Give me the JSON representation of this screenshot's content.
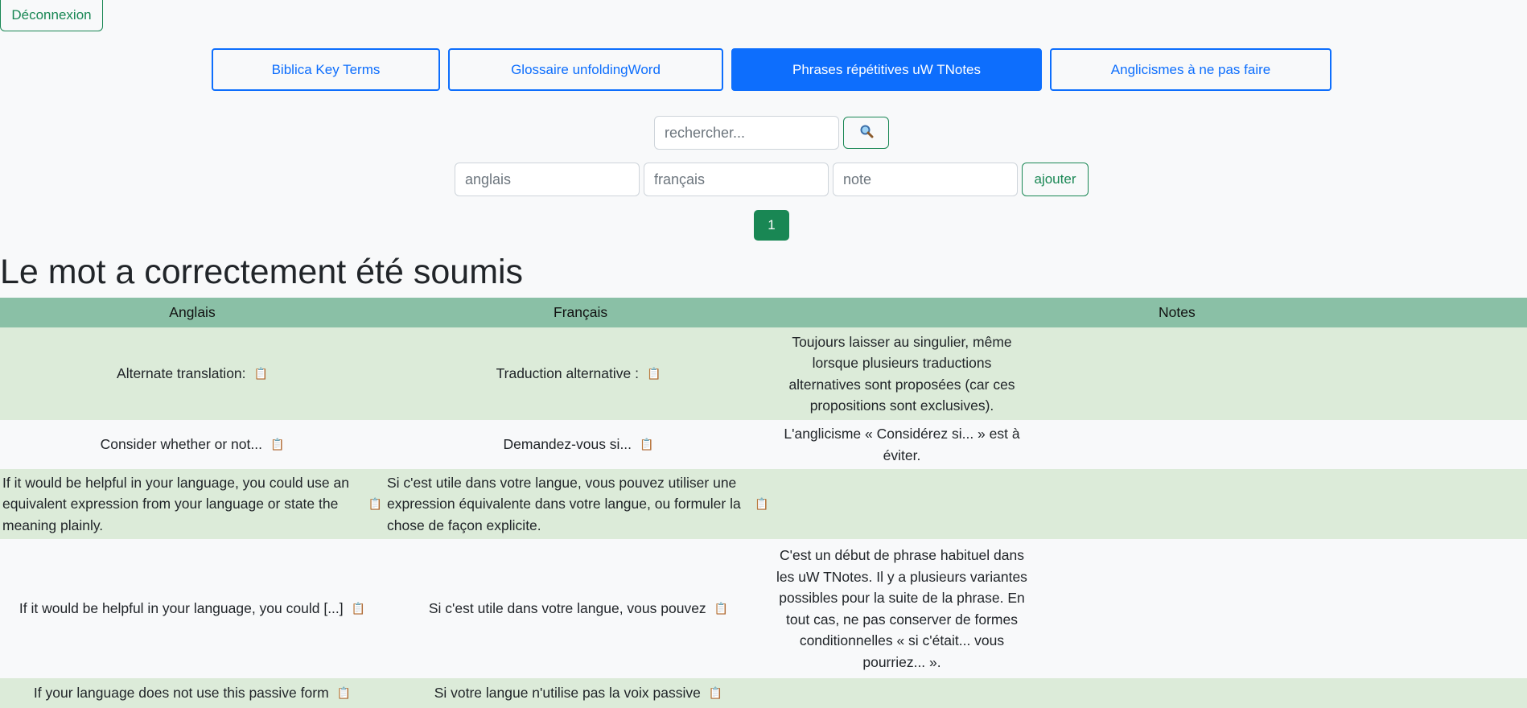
{
  "header": {
    "logout_label": "Déconnexion"
  },
  "tabs": [
    {
      "label": "Biblica Key Terms",
      "active": false
    },
    {
      "label": "Glossaire unfoldingWord",
      "active": false
    },
    {
      "label": "Phrases répétitives uW TNotes",
      "active": true
    },
    {
      "label": "Anglicismes à ne pas faire",
      "active": false
    }
  ],
  "search": {
    "placeholder": "rechercher...",
    "button_icon": "search-icon"
  },
  "add_form": {
    "english_placeholder": "anglais",
    "french_placeholder": "français",
    "note_placeholder": "note",
    "add_label": "ajouter"
  },
  "pagination": {
    "current_page": "1"
  },
  "message": "Le mot a correctement été soumis",
  "table": {
    "headers": {
      "english": "Anglais",
      "french": "Français",
      "notes": "Notes"
    },
    "rows": [
      {
        "english": "Alternate translation:",
        "french": "Traduction alternative :",
        "note": "Toujours laisser au singulier, même lorsque plusieurs traductions alternatives sont proposées (car ces propositions sont exclusives)."
      },
      {
        "english": "Consider whether or not...",
        "french": "Demandez-vous si...",
        "note": "L'anglicisme « Considérez si... » est à éviter."
      },
      {
        "english": "If it would be helpful in your language, you could use an equivalent expression from your language or state the meaning plainly.",
        "french": "Si c'est utile dans votre langue, vous pouvez utiliser une expression équivalente dans votre langue, ou formuler la chose de façon explicite.",
        "note": ""
      },
      {
        "english": "If it would be helpful in your language, you could [...]",
        "french": "Si c'est utile dans votre langue, vous pouvez",
        "note": "C'est un début de phrase habituel dans les uW TNotes. Il y a plusieurs variantes possibles pour la suite de la phrase. En tout cas, ne pas conserver de formes conditionnelles « si c'était... vous pourriez... »."
      },
      {
        "english": "If your language does not use this passive form",
        "french": "Si votre langue n'utilise pas la voix passive",
        "note": ""
      }
    ]
  },
  "icons": {
    "copy": "clipboard-icon"
  },
  "colors": {
    "primary": "#0d6efd",
    "success": "#198754",
    "table_header": "#8ac0a6",
    "row_stripe": "#dcebd9"
  }
}
